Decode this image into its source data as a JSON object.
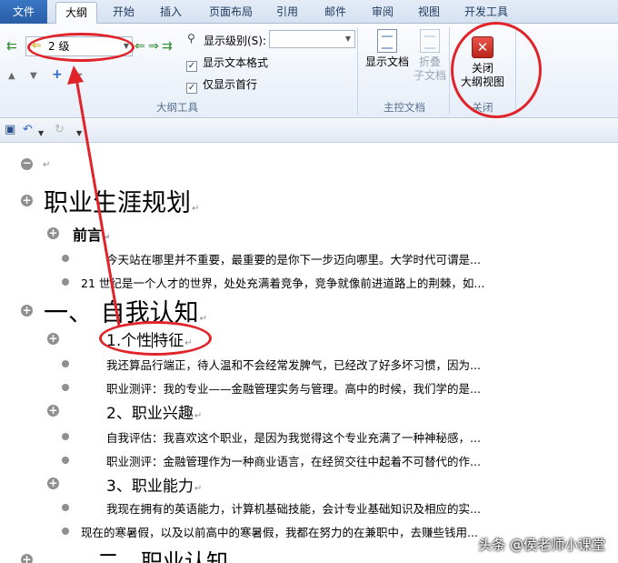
{
  "tabs": {
    "file": "文件",
    "outline": "大纲",
    "home": "开始",
    "insert": "插入",
    "page_layout": "页面布局",
    "references": "引用",
    "mailings": "邮件",
    "review": "审阅",
    "view": "视图",
    "developer": "开发工具"
  },
  "outline_tools": {
    "level_value": "2 级",
    "show_level_label": "显示级别(S):",
    "show_level_value": "",
    "show_text_format_label": "显示文本格式",
    "show_text_format_checked": true,
    "first_line_only_label": "仅显示首行",
    "first_line_only_checked": true,
    "group_label": "大纲工具"
  },
  "master_document": {
    "show_document_label": "显示文档",
    "collapse_label_1": "折叠",
    "collapse_label_2": "子文档",
    "group_label": "主控文档"
  },
  "close_group": {
    "close_label_1": "关闭",
    "close_label_2": "大纲视图",
    "group_label": "关闭"
  },
  "quick_access": {
    "save_icon": "save-icon",
    "undo_icon": "undo-icon",
    "redo_icon": "redo-icon"
  },
  "document": {
    "line_00": "",
    "line_01": "职业生涯规划",
    "line_02": "前言",
    "line_03": "今天站在哪里并不重要，最重要的是你下一步迈向哪里。大学时代可谓是...",
    "line_04": "21 世纪是一个人才的世界，处处充满着竞争，竞争就像前进道路上的荆棘，如...",
    "line_05": "一、 自我认知",
    "line_06a": "1.个性",
    "line_06b": "特征",
    "line_07": "我还算品行端正，待人温和不会经常发脾气，已经改了好多坏习惯，因为...",
    "line_08": "职业测评：我的专业——金融管理实务与管理。高中的时候，我们学的是...",
    "line_09": "2、职业兴趣",
    "line_10": "自我评估：我喜欢这个职业，是因为我觉得这个专业充满了一种神秘感，...",
    "line_11": "职业测评：金融管理作为一种商业语言，在经贸交往中起着不可替代的作...",
    "line_12": "3、职业能力",
    "line_13": "我现在拥有的英语能力，计算机基础技能，会计专业基础知识及相应的实...",
    "line_14": "现在的寒暑假，以及以前高中的寒暑假，我都在努力的在兼职中，去赚些钱用...",
    "line_15": "二、职业认知"
  },
  "paragraph_mark": "↵",
  "watermark": "头条 @侯老师小课堂",
  "colors": {
    "annotation_red": "#e0242a",
    "file_tab_blue": "#2a5da6",
    "promote_green": "#2e8b2e"
  }
}
